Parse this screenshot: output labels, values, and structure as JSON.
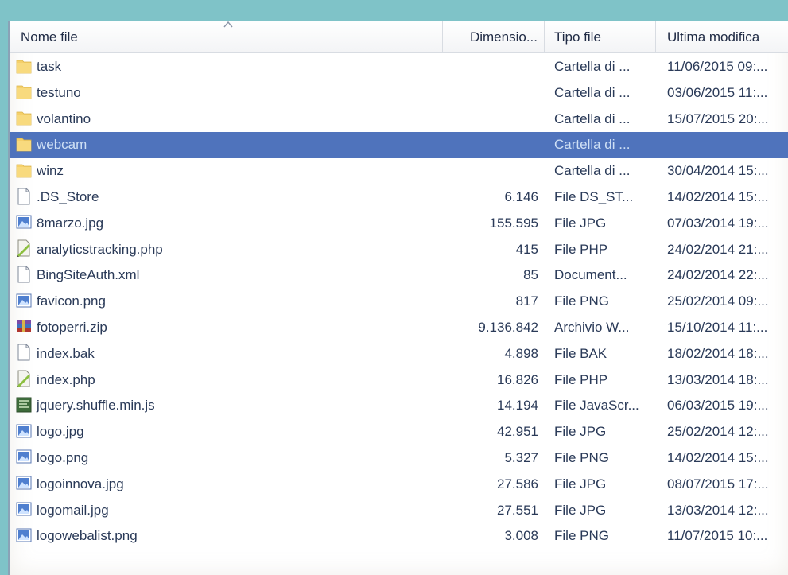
{
  "columns": {
    "name": "Nome file",
    "size": "Dimensio...",
    "type": "Tipo file",
    "date": "Ultima modifica"
  },
  "files": [
    {
      "name": "task",
      "size": "",
      "type": "Cartella di ...",
      "date": "11/06/2015 09:...",
      "icon": "folder-icon"
    },
    {
      "name": "testuno",
      "size": "",
      "type": "Cartella di ...",
      "date": "03/06/2015 11:...",
      "icon": "folder-icon"
    },
    {
      "name": "volantino",
      "size": "",
      "type": "Cartella di ...",
      "date": "15/07/2015 20:...",
      "icon": "folder-icon"
    },
    {
      "name": "webcam",
      "size": "",
      "type": "Cartella di ...",
      "date": "",
      "icon": "folder-icon",
      "selected": true
    },
    {
      "name": "winz",
      "size": "",
      "type": "Cartella di ...",
      "date": "30/04/2014 15:...",
      "icon": "folder-icon"
    },
    {
      "name": ".DS_Store",
      "size": "6.146",
      "type": "File DS_ST...",
      "date": "14/02/2014 15:...",
      "icon": "file-icon"
    },
    {
      "name": "8marzo.jpg",
      "size": "155.595",
      "type": "File JPG",
      "date": "07/03/2014 19:...",
      "icon": "image-icon"
    },
    {
      "name": "analyticstracking.php",
      "size": "415",
      "type": "File PHP",
      "date": "24/02/2014 21:...",
      "icon": "php-icon"
    },
    {
      "name": "BingSiteAuth.xml",
      "size": "85",
      "type": "Document...",
      "date": "24/02/2014 22:...",
      "icon": "file-icon"
    },
    {
      "name": "favicon.png",
      "size": "817",
      "type": "File PNG",
      "date": "25/02/2014 09:...",
      "icon": "image-icon"
    },
    {
      "name": "fotoperri.zip",
      "size": "9.136.842",
      "type": "Archivio W...",
      "date": "15/10/2014 11:...",
      "icon": "archive-icon"
    },
    {
      "name": "index.bak",
      "size": "4.898",
      "type": "File BAK",
      "date": "18/02/2014 18:...",
      "icon": "file-icon"
    },
    {
      "name": "index.php",
      "size": "16.826",
      "type": "File PHP",
      "date": "13/03/2014 18:...",
      "icon": "php-icon"
    },
    {
      "name": "jquery.shuffle.min.js",
      "size": "14.194",
      "type": "File JavaScr...",
      "date": "06/03/2015 19:...",
      "icon": "script-icon"
    },
    {
      "name": "logo.jpg",
      "size": "42.951",
      "type": "File JPG",
      "date": "25/02/2014 12:...",
      "icon": "image-icon"
    },
    {
      "name": "logo.png",
      "size": "5.327",
      "type": "File PNG",
      "date": "14/02/2014 15:...",
      "icon": "image-icon"
    },
    {
      "name": "logoinnova.jpg",
      "size": "27.586",
      "type": "File JPG",
      "date": "08/07/2015 17:...",
      "icon": "image-icon"
    },
    {
      "name": "logomail.jpg",
      "size": "27.551",
      "type": "File JPG",
      "date": "13/03/2014 12:...",
      "icon": "image-icon"
    },
    {
      "name": "logowebalist.png",
      "size": "3.008",
      "type": "File PNG",
      "date": "11/07/2015 10:...",
      "icon": "image-icon"
    }
  ],
  "colors": {
    "background": "#7fc3c8",
    "selection": "#4f73bc",
    "folder": "#f5d06a",
    "text": "#2a3a58"
  }
}
